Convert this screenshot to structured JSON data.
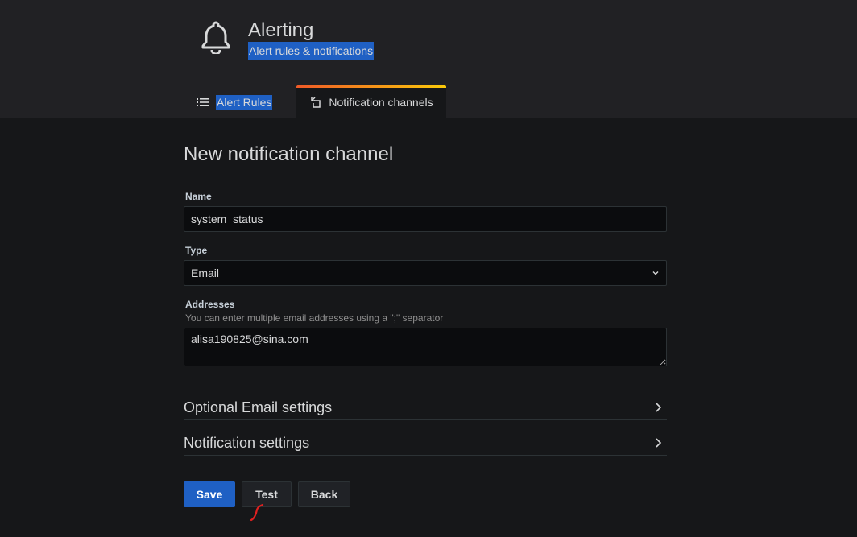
{
  "header": {
    "title": "Alerting",
    "subtitle": "Alert rules & notifications",
    "icon": "bell-icon"
  },
  "tabs": [
    {
      "label": "Alert Rules",
      "icon": "list-icon",
      "active": false
    },
    {
      "label": "Notification channels",
      "icon": "channel-icon",
      "active": true
    }
  ],
  "form": {
    "title": "New notification channel",
    "name_label": "Name",
    "name_value": "system_status",
    "type_label": "Type",
    "type_value": "Email",
    "addresses_label": "Addresses",
    "addresses_description": "You can enter multiple email addresses using a \";\" separator",
    "addresses_value": "alisa190825@sina.com"
  },
  "sections": {
    "optional_email": "Optional Email settings",
    "notification": "Notification settings"
  },
  "buttons": {
    "save": "Save",
    "test": "Test",
    "back": "Back"
  },
  "colors": {
    "primary": "#1f60c4",
    "tab_accent_start": "#f05a28",
    "tab_accent_end": "#fbca0a",
    "annotation": "#e02020"
  }
}
